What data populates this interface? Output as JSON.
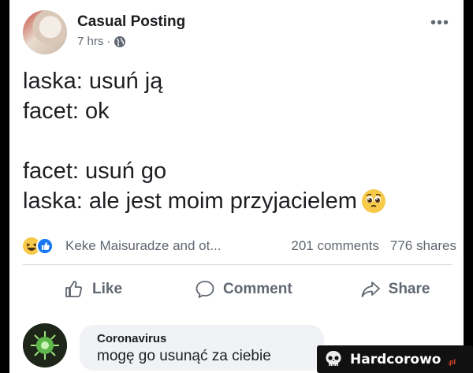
{
  "post": {
    "author": "Casual Posting",
    "time": "7 hrs",
    "time_separator": "·",
    "lines": [
      "laska: usuń ją",
      "facet: ok",
      "",
      "facet: usuń go",
      "laska: ale jest moim przyjacielem"
    ],
    "icons": {
      "privacy": "globe-icon",
      "more": "more-options-icon",
      "end_emoji": "pleading-face-emoji"
    }
  },
  "stats": {
    "reactions_text": "Keke Maisuradze and ot...",
    "comments": "201 comments",
    "shares": "776 shares",
    "reaction_icons": [
      "haha-reaction-icon",
      "like-reaction-icon"
    ],
    "colors": {
      "like": "#1877f2",
      "haha": "#f7c948"
    }
  },
  "actions": {
    "like": "Like",
    "comment": "Comment",
    "share": "Share"
  },
  "comment": {
    "author": "Coronavirus",
    "text": "mogę go usunąć za ciebie"
  },
  "watermark": {
    "name": "Hardcorowo",
    "tld": ".pl"
  }
}
